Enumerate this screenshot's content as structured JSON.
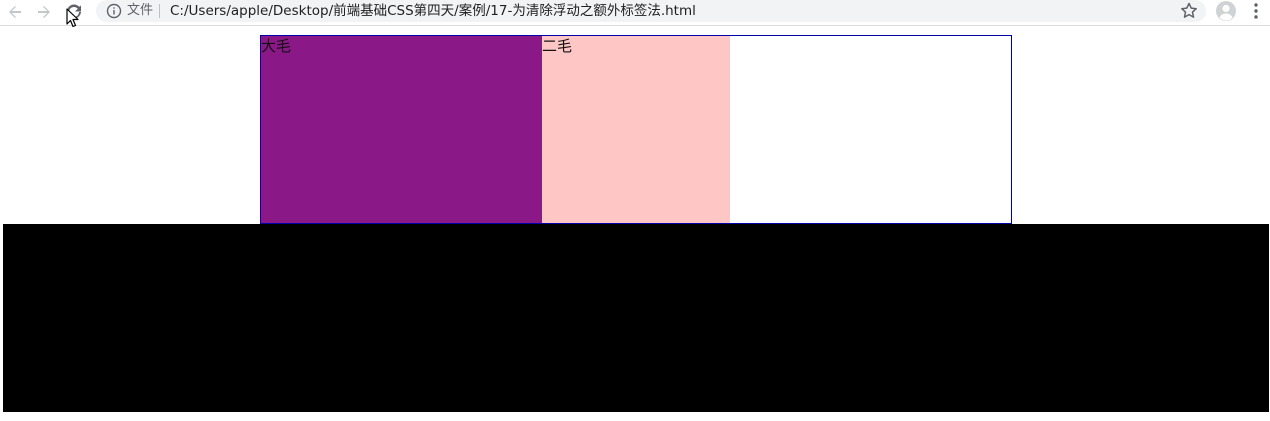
{
  "browser": {
    "file_label": "文件",
    "url": "C:/Users/apple/Desktop/前端基础CSS第四天/案例/17-为清除浮动之额外标签法.html",
    "icons": [
      "back-arrow-icon",
      "forward-arrow-icon",
      "reload-icon",
      "info-icon",
      "star-icon",
      "profile-icon",
      "menu-icon"
    ]
  },
  "page": {
    "box1_label": "大毛",
    "box2_label": "二毛",
    "colors": {
      "box1": "#8b1887",
      "box2": "#ffc6c6",
      "container_border": "#0000aa",
      "footer": "#000000"
    }
  }
}
